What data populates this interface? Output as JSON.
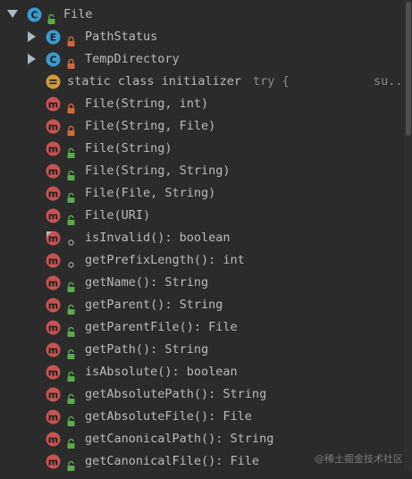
{
  "colors": {
    "background": "#2b2b2b",
    "text": "#bbbbbb",
    "method_icon": "#c75450",
    "class_icon": "#3a9bd0",
    "enum_icon": "#3a9bd0",
    "initializer_icon": "#d19a3a",
    "public_lock": "#5aab4a",
    "private_lock": "#d1683a"
  },
  "root": {
    "icon": "class-icon",
    "visibility": "public",
    "label": "File",
    "expanded": true
  },
  "nested": [
    {
      "icon": "enum-icon",
      "letter": "E",
      "visibility": "private",
      "label": "PathStatus"
    },
    {
      "icon": "class-icon",
      "letter": "C",
      "visibility": "private",
      "label": "TempDirectory"
    }
  ],
  "initializer": {
    "icon": "initializer-icon",
    "label": "static class initializer",
    "extra1": "try {",
    "extra2": "su..."
  },
  "members": [
    {
      "visibility": "private",
      "label": "File(String, int)"
    },
    {
      "visibility": "private",
      "label": "File(String, File)"
    },
    {
      "visibility": "public",
      "label": "File(String)"
    },
    {
      "visibility": "public",
      "label": "File(String, String)"
    },
    {
      "visibility": "public",
      "label": "File(File, String)"
    },
    {
      "visibility": "public",
      "label": "File(URI)"
    },
    {
      "visibility": "package",
      "label": "isInvalid(): boolean",
      "overlay": true
    },
    {
      "visibility": "package",
      "label": "getPrefixLength(): int"
    },
    {
      "visibility": "public",
      "label": "getName(): String"
    },
    {
      "visibility": "public",
      "label": "getParent(): String"
    },
    {
      "visibility": "public",
      "label": "getParentFile(): File"
    },
    {
      "visibility": "public",
      "label": "getPath(): String"
    },
    {
      "visibility": "public",
      "label": "isAbsolute(): boolean"
    },
    {
      "visibility": "public",
      "label": "getAbsolutePath(): String"
    },
    {
      "visibility": "public",
      "label": "getAbsoluteFile(): File"
    },
    {
      "visibility": "public",
      "label": "getCanonicalPath(): String"
    },
    {
      "visibility": "public",
      "label": "getCanonicalFile(): File"
    }
  ],
  "watermark": "@稀土掘金技术社区"
}
